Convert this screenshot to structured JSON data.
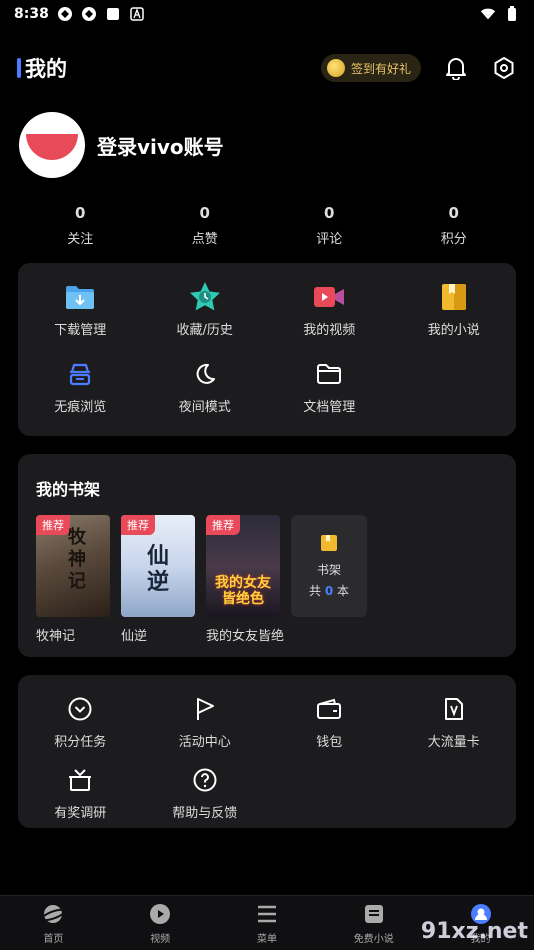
{
  "status_bar": {
    "time": "8:38"
  },
  "header": {
    "title": "我的",
    "checkin_label": "签到有好礼"
  },
  "profile": {
    "login_text": "登录vivo账号"
  },
  "stats": [
    {
      "value": "0",
      "label": "关注"
    },
    {
      "value": "0",
      "label": "点赞"
    },
    {
      "value": "0",
      "label": "评论"
    },
    {
      "value": "0",
      "label": "积分"
    }
  ],
  "tools": [
    {
      "label": "下载管理",
      "icon": "download-folder-icon"
    },
    {
      "label": "收藏/历史",
      "icon": "star-clock-icon"
    },
    {
      "label": "我的视频",
      "icon": "video-camera-icon"
    },
    {
      "label": "我的小说",
      "icon": "book-icon"
    },
    {
      "label": "无痕浏览",
      "icon": "incognito-icon"
    },
    {
      "label": "夜间模式",
      "icon": "moon-icon"
    },
    {
      "label": "文档管理",
      "icon": "folder-icon"
    }
  ],
  "bookshelf": {
    "title": "我的书架",
    "badge": "推荐",
    "books": [
      {
        "title": "牧神记",
        "cover_text": "牧神记"
      },
      {
        "title": "仙逆",
        "cover_text": "仙逆"
      },
      {
        "title": "我的女友皆绝色",
        "cover_text": "我的女友皆绝色"
      }
    ],
    "shelf_label": "书架",
    "count_prefix": "共",
    "count": "0",
    "count_suffix": "本"
  },
  "services": [
    {
      "label": "积分任务",
      "icon": "chevron-circle-icon"
    },
    {
      "label": "活动中心",
      "icon": "flag-icon"
    },
    {
      "label": "钱包",
      "icon": "wallet-icon"
    },
    {
      "label": "大流量卡",
      "icon": "sim-card-icon"
    },
    {
      "label": "有奖调研",
      "icon": "gift-box-icon"
    },
    {
      "label": "帮助与反馈",
      "icon": "help-circle-icon"
    }
  ],
  "bottom_nav": [
    {
      "label": "首页",
      "icon": "home-planet-icon"
    },
    {
      "label": "视频",
      "icon": "play-circle-icon"
    },
    {
      "label": "菜单",
      "icon": "menu-icon"
    },
    {
      "label": "免费小说",
      "icon": "novel-icon"
    },
    {
      "label": "我的",
      "icon": "profile-icon"
    }
  ],
  "watermark": "91xz.net",
  "colors": {
    "accent": "#4a7dff",
    "badge": "#e94a5a",
    "card": "#1c1c1e",
    "checkin_text": "#e9c56a"
  }
}
